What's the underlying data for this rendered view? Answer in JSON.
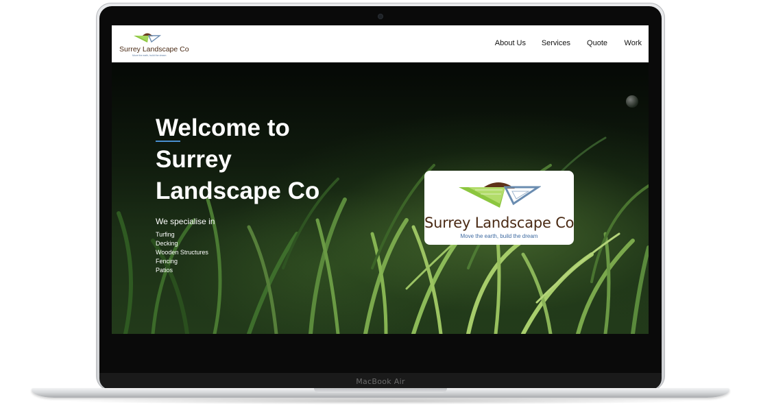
{
  "device": {
    "label": "MacBook Air"
  },
  "header": {
    "brand": "Surrey Landscape Co",
    "tagline": "Move the earth, build the dream",
    "nav": [
      "About Us",
      "Services",
      "Quote",
      "Work"
    ]
  },
  "hero": {
    "title_line1": "Welcome to",
    "title_line2": "Surrey",
    "title_line3": "Landscape Co",
    "specialise_heading": "We specialise in",
    "services": [
      "Turfing",
      "Decking",
      "Wooden Structures",
      "Fencing",
      "Patios"
    ]
  },
  "logo_card": {
    "brand": "Surrey Landscape Co",
    "tagline": "Move the earth, build the dream"
  },
  "colors": {
    "brand_brown": "#4a2a14",
    "logo_green": "#8cc63f",
    "tagline_blue": "#3e6aa0",
    "accent_blue": "#4a8fd0"
  },
  "icons": [
    "landscape-logo-icon"
  ]
}
